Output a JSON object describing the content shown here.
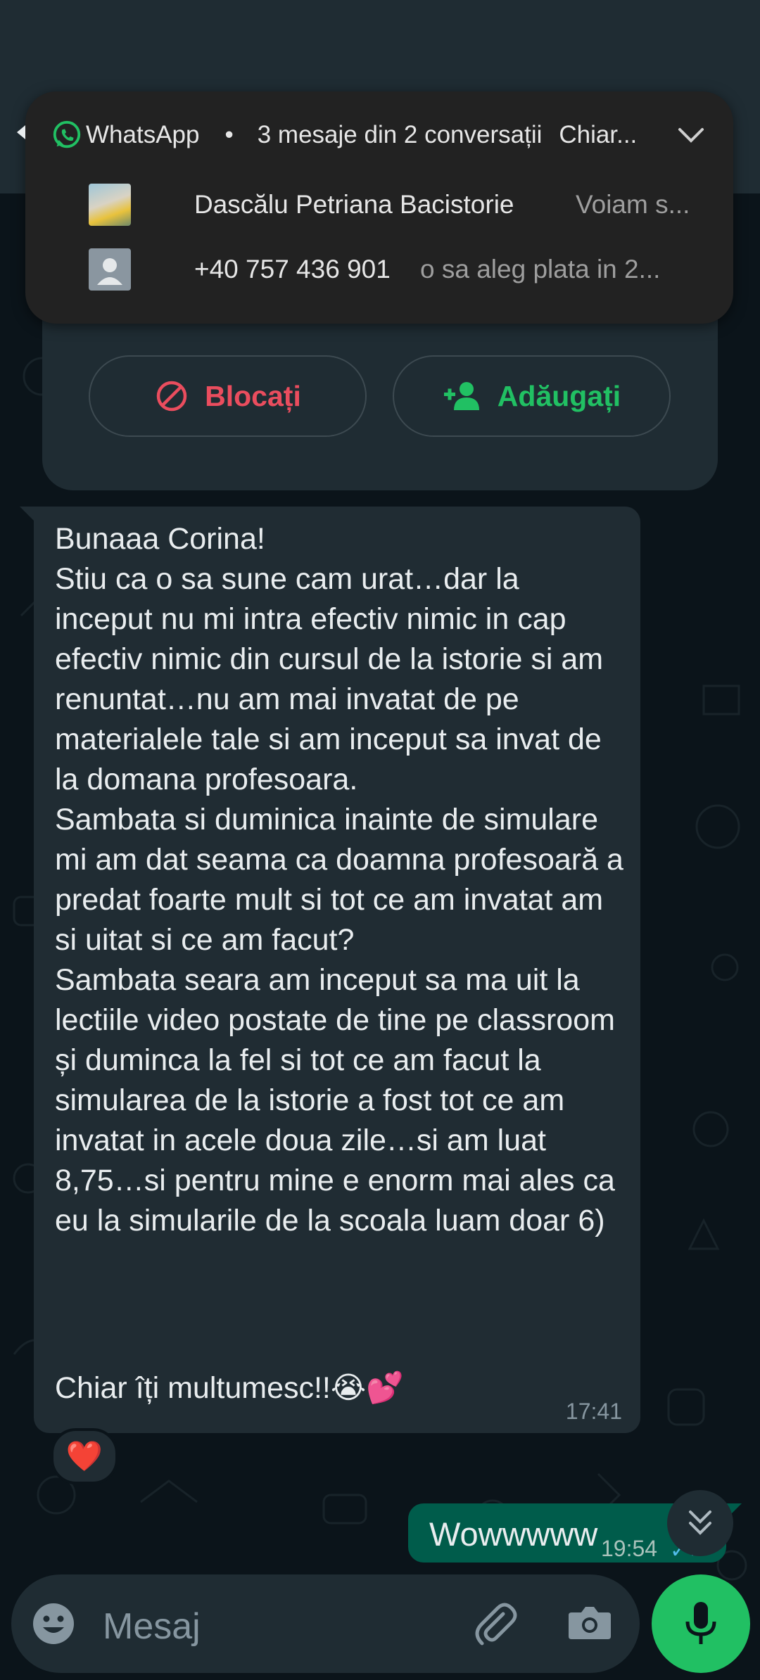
{
  "notification": {
    "app_name": "WhatsApp",
    "separator": "•",
    "summary": "3 mesaje din 2 conversații",
    "preview": "Chiar...",
    "rows": [
      {
        "name": "Dascălu Petriana Bacistorie",
        "message": "Voiam s..."
      },
      {
        "name": "+40 757 436 901",
        "message": "o sa aleg plata in 2..."
      }
    ]
  },
  "actions": {
    "block_label": "Blocați",
    "add_label": "Adăugați"
  },
  "incoming_message": {
    "text": "Bunaaa Corina!\nStiu ca o sa sune cam urat…dar la inceput nu mi intra efectiv nimic in cap efectiv nimic din cursul de la istorie si am renuntat…nu am mai invatat de pe materialele tale si am inceput sa invat de la domana profesoara.\nSambata si duminica inainte de simulare mi am dat seama ca doamna profesoară a predat foarte mult si tot ce am invatat am si uitat si ce am facut?\nSambata seara am inceput sa ma uit la lectiile video postate de tine pe classroom și duminca la fel si tot ce am facut la simularea de la istorie a fost tot ce am invatat in acele doua zile…si am luat 8,75…si pentru mine e enorm mai ales ca eu la simularile de la scoala luam doar 6)",
    "last_line": "Chiar îți multumesc!!😭💕",
    "time": "17:41",
    "reaction": "❤️"
  },
  "outgoing_message": {
    "text": "Wowwwww",
    "time": "19:54",
    "status": "✓✓"
  },
  "composer": {
    "placeholder": "Mesaj"
  },
  "colors": {
    "accent": "#21c063",
    "danger": "#ea4d5e",
    "bubble_in": "#202c33",
    "bubble_out": "#005c4b"
  },
  "icons": [
    "whatsapp-icon",
    "chevron-down-icon",
    "block-icon",
    "add-contact-icon",
    "double-chevron-down-icon",
    "emoji-icon",
    "attach-icon",
    "camera-icon",
    "microphone-icon"
  ]
}
